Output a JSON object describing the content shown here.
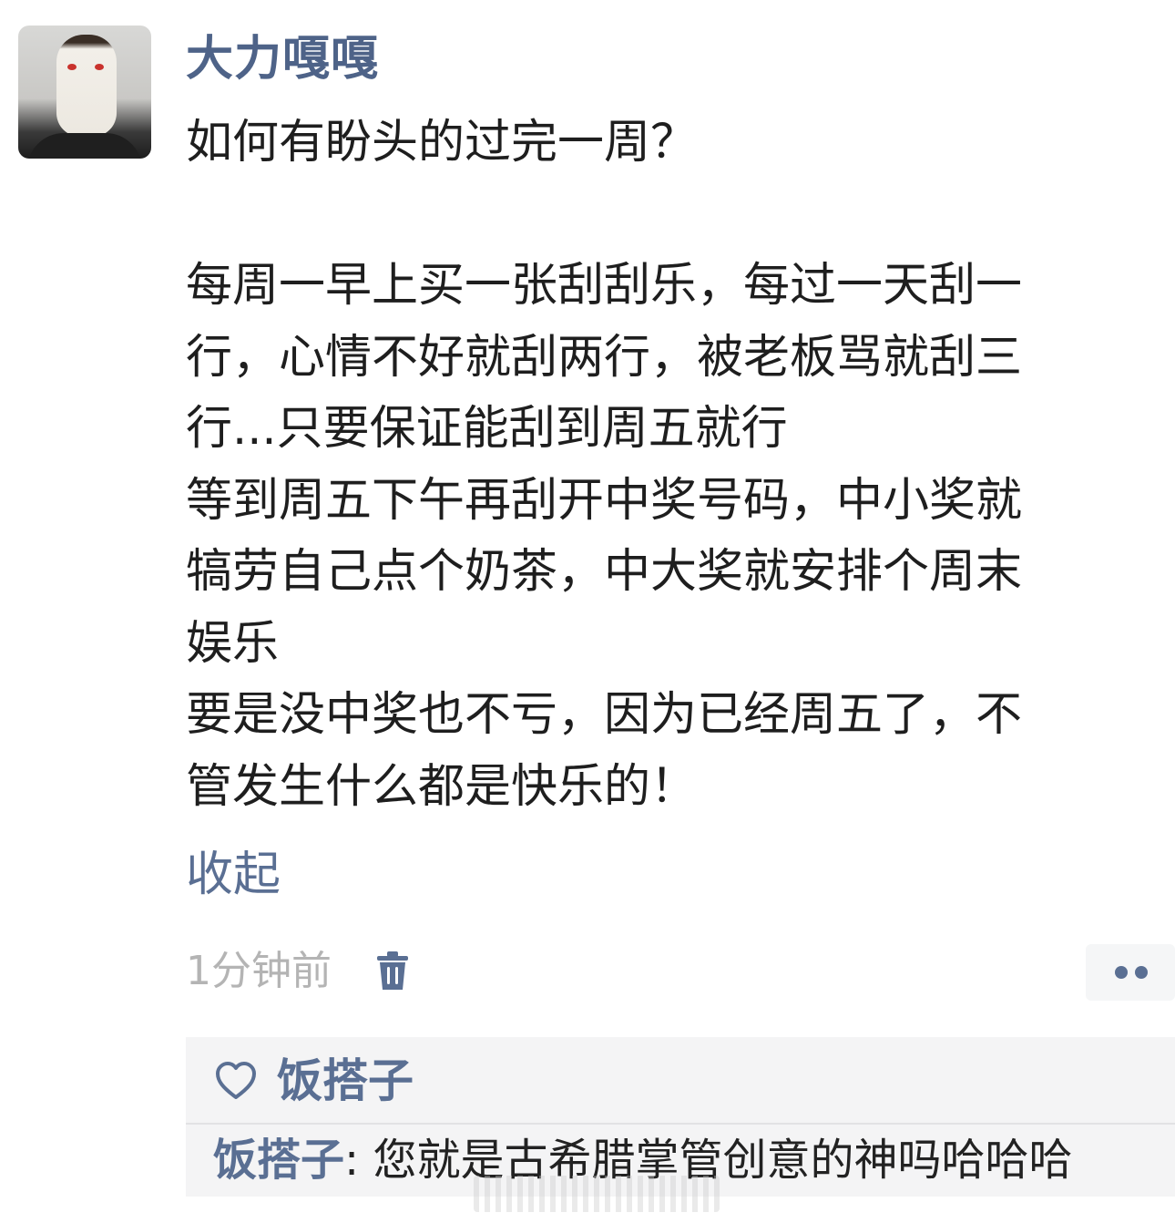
{
  "post": {
    "username": "大力嘎嘎",
    "content": "如何有盼头的过完一周？\n\n每周一早上买一张刮刮乐，每过一天刮一\n行，心情不好就刮两行，被老板骂就刮三\n行...只要保证能刮到周五就行\n等到周五下午再刮开中奖号码，中小奖就\n犒劳自己点个奶茶，中大奖就安排个周末\n娱乐\n要是没中奖也不亏，因为已经周五了，不\n管发生什么都是快乐的！",
    "collapse_label": "收起",
    "time": "1分钟前"
  },
  "likes": {
    "names": "饭搭子"
  },
  "comments": [
    {
      "author": "饭搭子",
      "separator": ": ",
      "text": "您就是古希腊掌管创意的神吗哈哈哈"
    }
  ],
  "icons": {
    "avatar": "avatar-photo",
    "delete": "trash-icon",
    "more": "more-dots-icon",
    "like": "heart-outline-icon"
  },
  "colors": {
    "link": "#5a6f93",
    "username": "#4e6388",
    "meta": "#b4b4b4",
    "comment_bg": "#f4f4f5"
  }
}
